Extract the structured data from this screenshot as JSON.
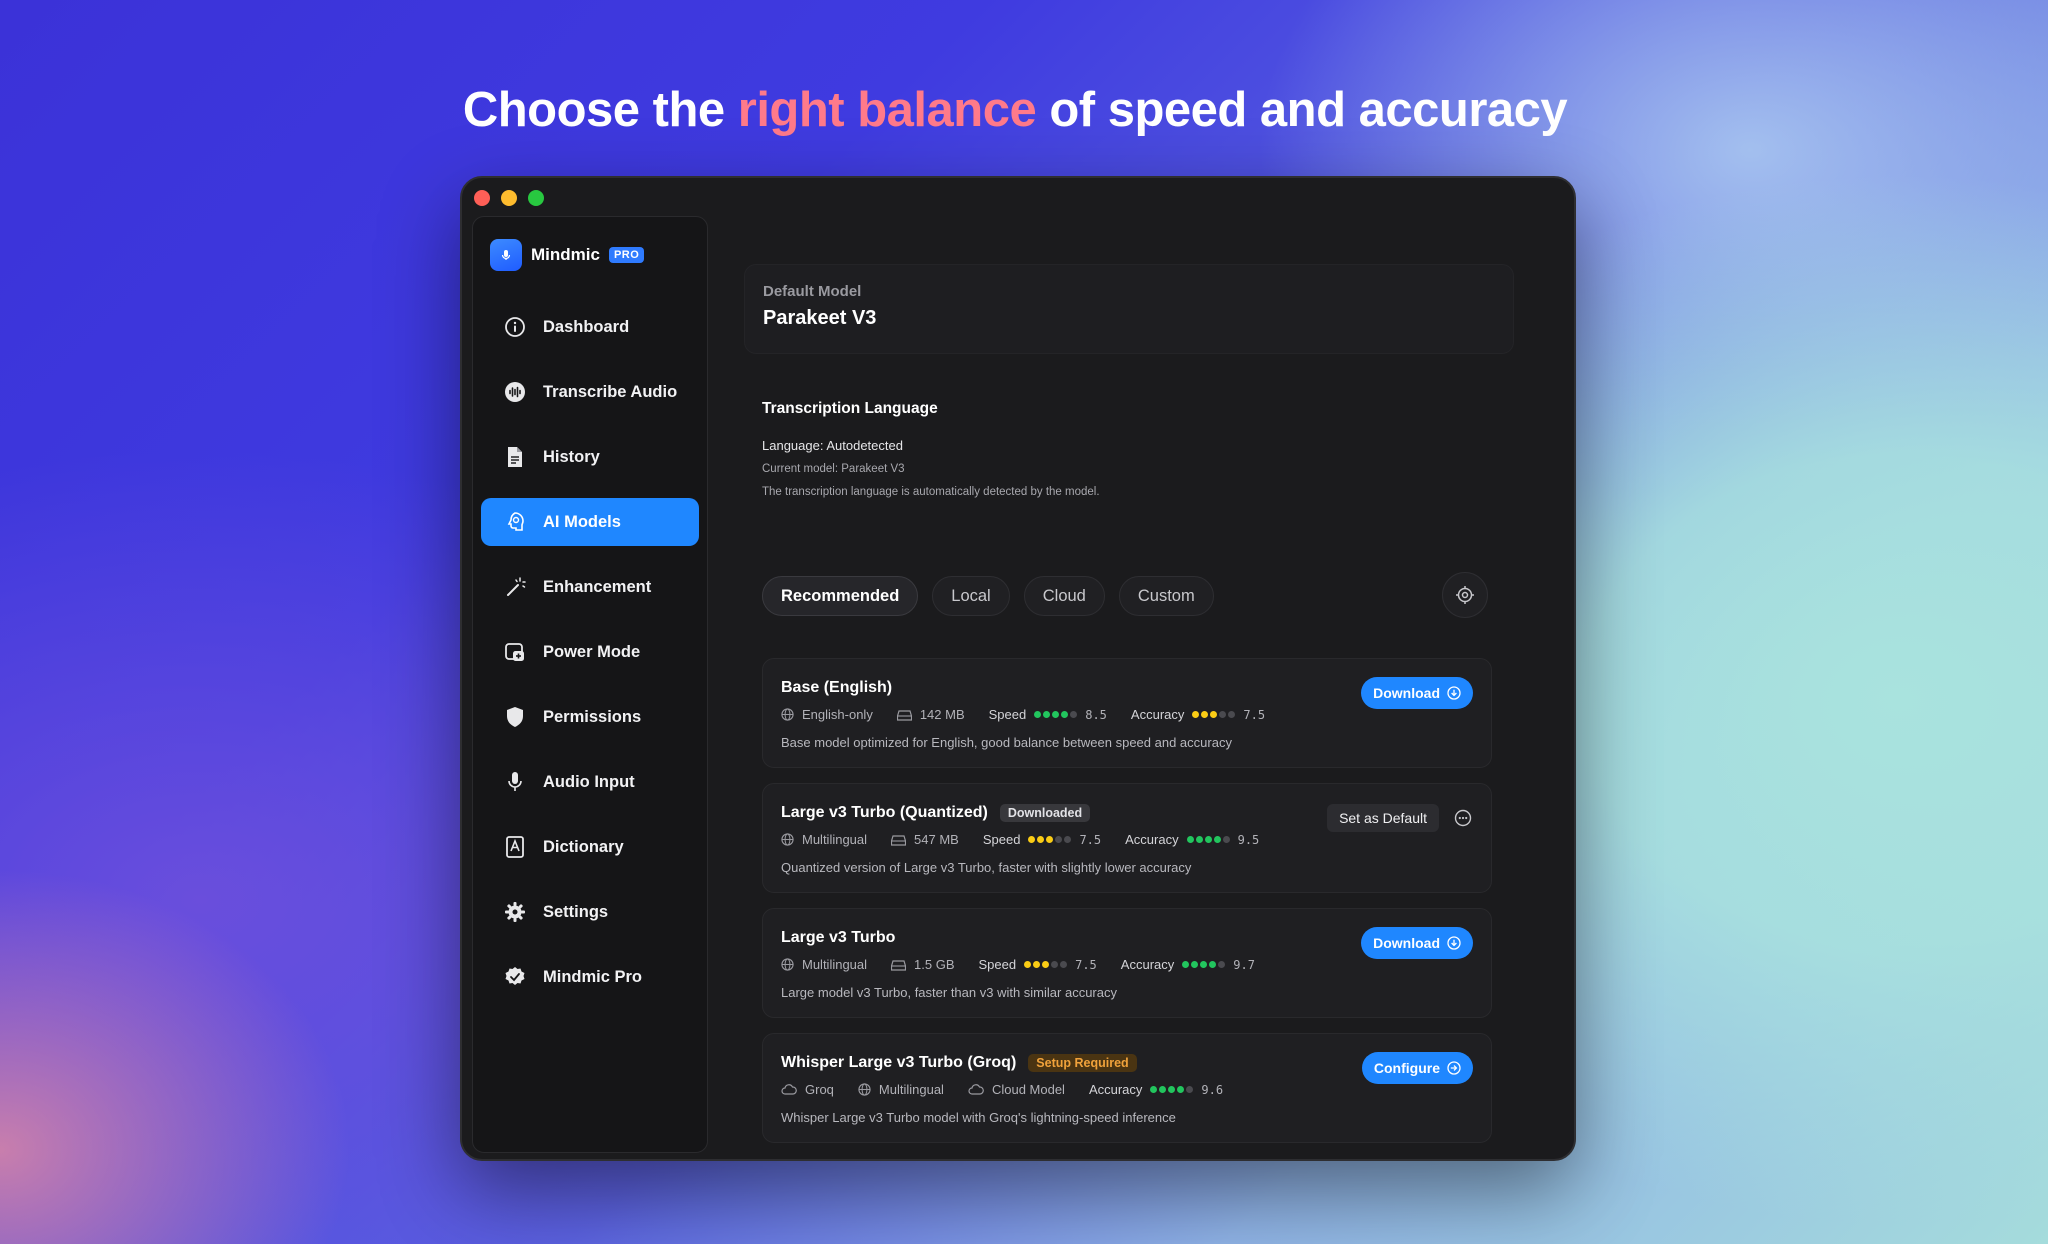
{
  "headline": {
    "part1": "Choose the ",
    "accent": "right balance",
    "part2": " of speed and accuracy"
  },
  "brand": {
    "name": "Mindmic",
    "badge": "PRO"
  },
  "sidebar": {
    "items": [
      {
        "label": "Dashboard",
        "icon": "info-circle-icon"
      },
      {
        "label": "Transcribe Audio",
        "icon": "waveform-icon"
      },
      {
        "label": "History",
        "icon": "document-icon"
      },
      {
        "label": "AI Models",
        "icon": "brain-head-icon",
        "active": true
      },
      {
        "label": "Enhancement",
        "icon": "magic-wand-icon"
      },
      {
        "label": "Power Mode",
        "icon": "app-plus-icon"
      },
      {
        "label": "Permissions",
        "icon": "shield-icon"
      },
      {
        "label": "Audio Input",
        "icon": "microphone-icon"
      },
      {
        "label": "Dictionary",
        "icon": "dictionary-icon"
      },
      {
        "label": "Settings",
        "icon": "gear-icon"
      },
      {
        "label": "Mindmic Pro",
        "icon": "verified-badge-icon"
      }
    ]
  },
  "default_model": {
    "label": "Default Model",
    "value": "Parakeet V3"
  },
  "language": {
    "title": "Transcription Language",
    "line1": "Language: Autodetected",
    "line2": "Current model: Parakeet V3",
    "line3": "The transcription language is automatically detected by the model."
  },
  "tabs": [
    "Recommended",
    "Local",
    "Cloud",
    "Custom"
  ],
  "models": [
    {
      "name": "Base (English)",
      "meta1": "English-only",
      "size": "142 MB",
      "speed_label": "Speed",
      "speed": "8.5",
      "accuracy_label": "Accuracy",
      "accuracy": "7.5",
      "desc": "Base model optimized for English, good balance between speed and accuracy",
      "action": "Download"
    },
    {
      "name": "Large v3 Turbo (Quantized)",
      "badge": "Downloaded",
      "meta1": "Multilingual",
      "size": "547 MB",
      "speed_label": "Speed",
      "speed": "7.5",
      "accuracy_label": "Accuracy",
      "accuracy": "9.5",
      "desc": "Quantized version of Large v3 Turbo, faster with slightly lower accuracy",
      "action": "Set as Default"
    },
    {
      "name": "Large v3 Turbo",
      "meta1": "Multilingual",
      "size": "1.5 GB",
      "speed_label": "Speed",
      "speed": "7.5",
      "accuracy_label": "Accuracy",
      "accuracy": "9.7",
      "desc": "Large model v3 Turbo, faster than v3 with similar accuracy",
      "action": "Download"
    },
    {
      "name": "Whisper Large v3 Turbo (Groq)",
      "badge": "Setup Required",
      "provider": "Groq",
      "meta1": "Multilingual",
      "type": "Cloud Model",
      "accuracy_label": "Accuracy",
      "accuracy": "9.6",
      "desc": "Whisper Large v3 Turbo model with Groq's lightning-speed inference",
      "action": "Configure"
    }
  ],
  "colors": {
    "accent": "#1f87ff",
    "headline_accent": "#ff7a8a",
    "dot_green": "#22c55e",
    "dot_yellow": "#facc15"
  }
}
